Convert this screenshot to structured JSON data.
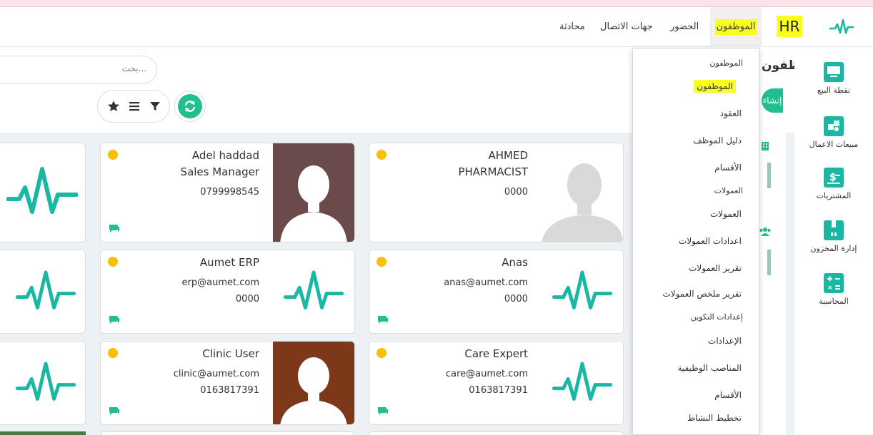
{
  "navbar": {
    "brand": "HR",
    "items": [
      {
        "label": "الموظفون",
        "active": true,
        "highlighted": true
      },
      {
        "label": "الحضور"
      },
      {
        "label": "جهات الاتصال"
      },
      {
        "label": "محادثة"
      }
    ]
  },
  "sidebar": {
    "apps": [
      {
        "label": "نقطة البيع",
        "icon": "monitor-icon"
      },
      {
        "label": "مبيعات الاعمال",
        "icon": "sales-icon"
      },
      {
        "label": "المشتريات",
        "icon": "dollar-icon"
      },
      {
        "label": "إدارة المخزون",
        "icon": "inventory-box-icon"
      },
      {
        "label": "المحاسبة",
        "icon": "calculator-icon"
      }
    ]
  },
  "panel": {
    "title": "الموظفون",
    "create_label": "إنشاء",
    "search_placeholder": "بحث..."
  },
  "dropdown": {
    "items": [
      {
        "label": "الموظفون",
        "type": "header"
      },
      {
        "label": "الموظفون",
        "type": "item",
        "highlighted": true
      },
      {
        "label": "العقود",
        "type": "item"
      },
      {
        "label": "دليل الموظف",
        "type": "item"
      },
      {
        "label": "الأقسام",
        "type": "item"
      },
      {
        "label": "العمولات",
        "type": "header"
      },
      {
        "label": "العمولات",
        "type": "item"
      },
      {
        "label": "اعدادات العمولات",
        "type": "item"
      },
      {
        "label": "تقرير العمولات",
        "type": "item"
      },
      {
        "label": "تقرير ملخص العمولات",
        "type": "item"
      },
      {
        "label": "إعدادات التكوين",
        "type": "header"
      },
      {
        "label": "الإعدادات",
        "type": "item"
      },
      {
        "label": "المناصب الوظيفية",
        "type": "item"
      },
      {
        "label": "الأقسام",
        "type": "item"
      },
      {
        "label": "تخطيط النشاط",
        "type": "item"
      }
    ]
  },
  "employees": [
    {
      "name": "Adel haddad",
      "job": "Sales Manager",
      "phone": "0799998545",
      "avatar": "photo-dark"
    },
    {
      "name": "AHMED",
      "job": "PHARMACIST",
      "phone": "0000",
      "avatar": "photo-light"
    },
    {
      "name": "Aumet ERP",
      "email": "erp@aumet.com",
      "phone": "0000",
      "avatar": "logo"
    },
    {
      "name": "Anas",
      "email": "anas@aumet.com",
      "phone": "0000",
      "avatar": "logo"
    },
    {
      "name": "Clinic User",
      "email": "clinic@aumet.com",
      "phone": "0163817391",
      "avatar": "photo-brown"
    },
    {
      "name": "Care Expert",
      "email": "care@aumet.com",
      "phone": "0163817391",
      "avatar": "logo"
    }
  ],
  "colors": {
    "brand_teal": "#1ab8a4",
    "accent_green": "#1fbf8f",
    "status_yellow": "#f8c000",
    "highlight_yellow": "#fbff1f"
  }
}
